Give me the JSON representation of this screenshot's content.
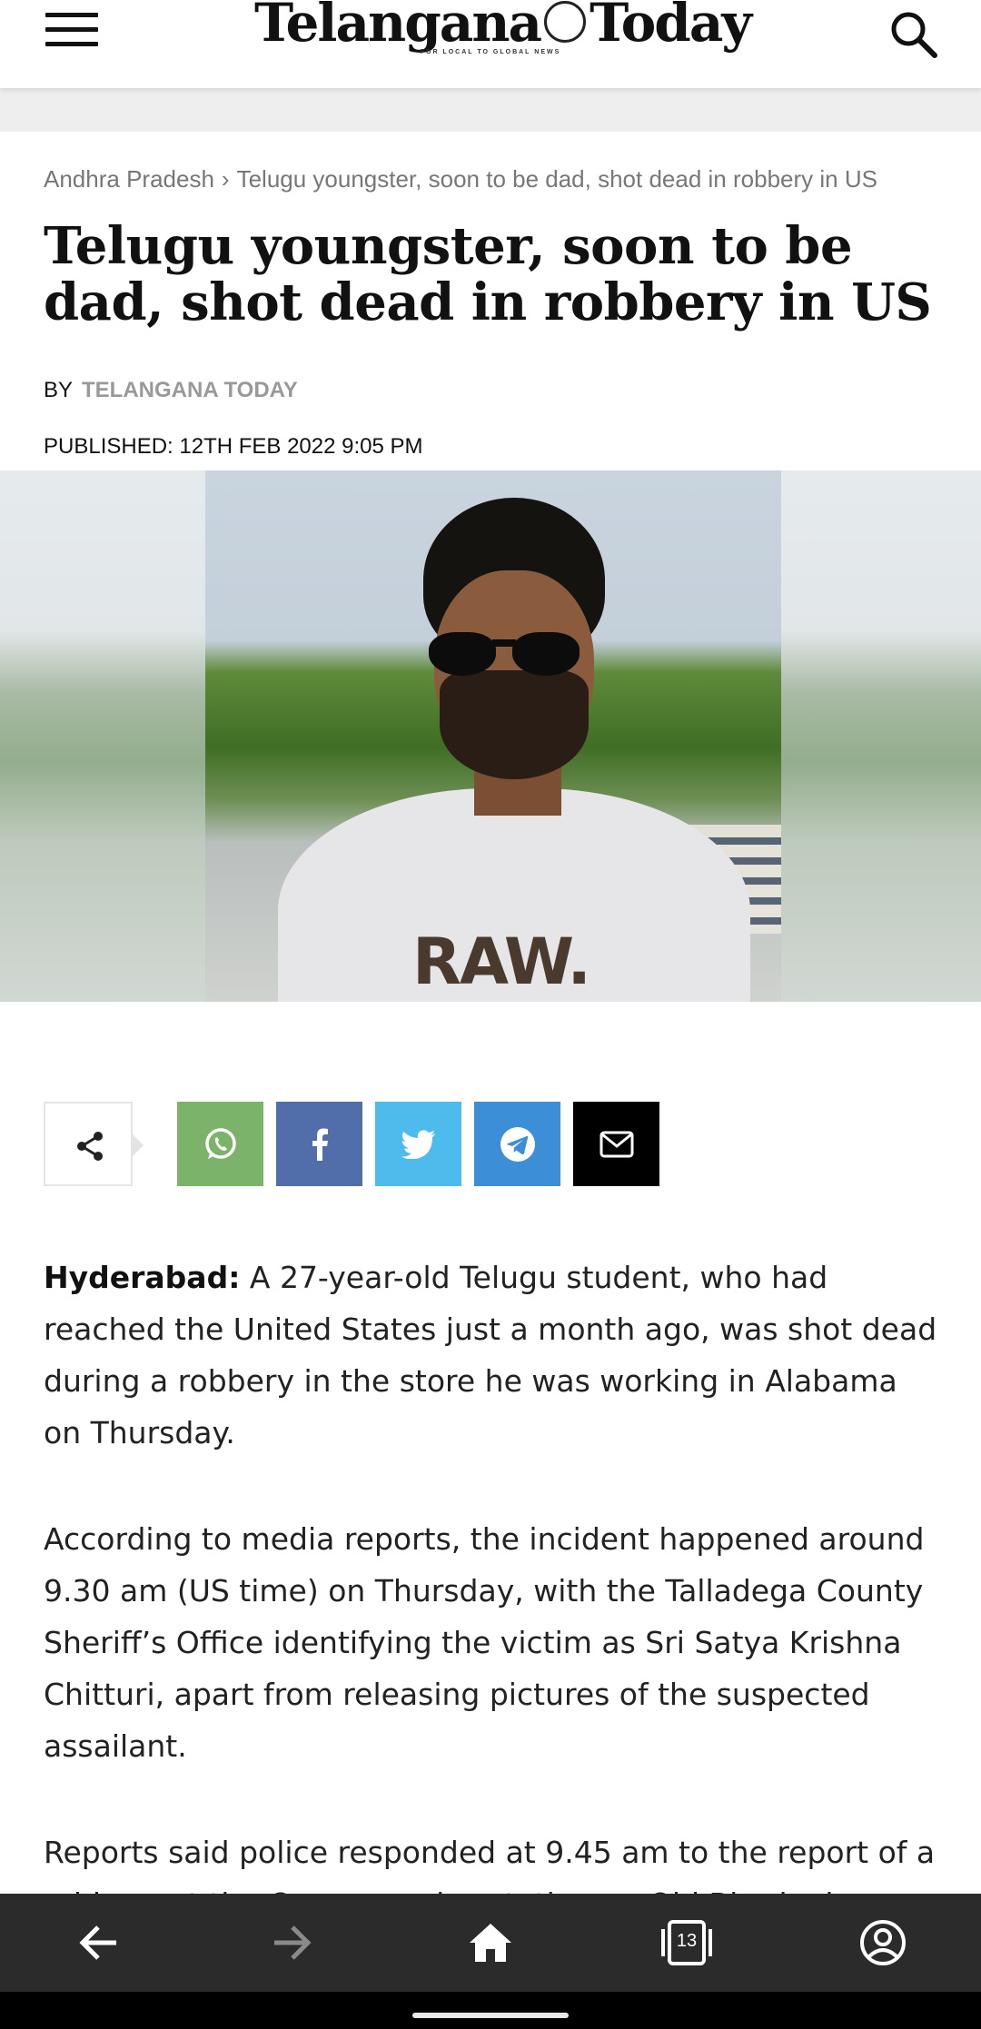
{
  "header": {
    "logo_left": "Telangana",
    "logo_right": "Today",
    "logo_tagline": "FOR LOCAL TO GLOBAL NEWS",
    "icons": [
      "menu-icon",
      "search-icon"
    ]
  },
  "breadcrumb": {
    "section": "Andhra Pradesh",
    "separator": "›",
    "current": "Telugu youngster, soon to be dad, shot dead in robbery in US"
  },
  "article": {
    "headline": "Telugu youngster, soon to be dad, shot dead in robbery in US",
    "by_label": "BY",
    "author": "TELANGANA TODAY",
    "published": "PUBLISHED: 12TH FEB 2022 9:05 PM",
    "image_print": "RAW.",
    "dateline": "Hyderabad:",
    "p1": " A 27-year-old Telugu student, who had reached the United States just a month ago, was shot dead during a robbery in the store he was working in Alabama on Thursday.",
    "p2": "According to media reports, the incident happened around 9.30 am (US time) on Thursday, with the Talladega County Sheriff’s Office identifying the victim as Sri Satya Krishna Chitturi, apart from releasing pictures of the suspected assailant.",
    "p3": "Reports said police responded at 9.45 am to the report of a robbery at the Crown service station on Old Birmingham"
  },
  "share": {
    "icons": [
      "share-icon",
      "whatsapp-icon",
      "facebook-icon",
      "twitter-icon",
      "telegram-icon",
      "email-icon"
    ],
    "colors": {
      "whatsapp": "#7bb36a",
      "facebook": "#516eab",
      "twitter": "#4dbbec",
      "telegram": "#3c8fd6",
      "email": "#000000"
    }
  },
  "bottom_nav": {
    "tab_count": "13",
    "icons": [
      "back-arrow-icon",
      "forward-arrow-icon",
      "home-icon",
      "tabs-icon",
      "account-icon"
    ],
    "background": "#2b2b2b"
  }
}
